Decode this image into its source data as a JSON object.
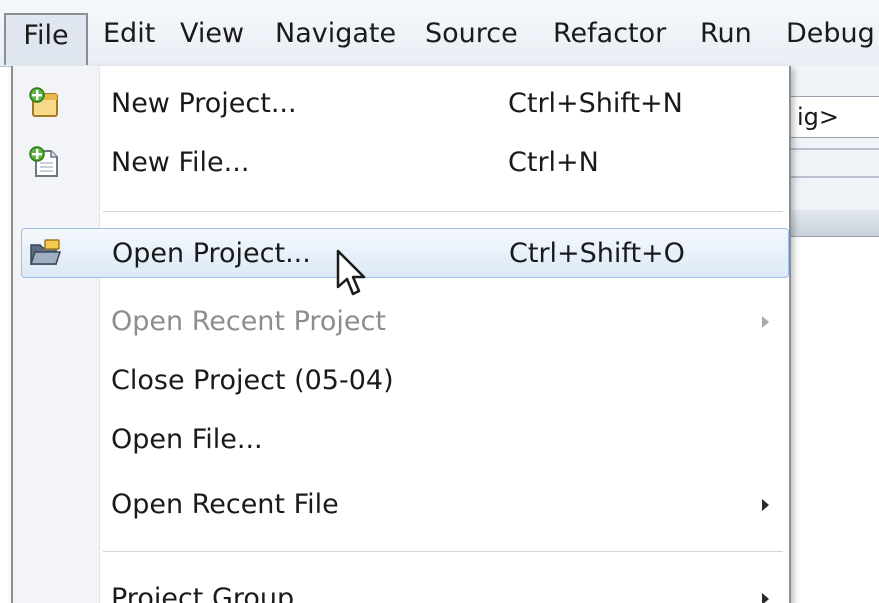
{
  "menubar": {
    "items": [
      {
        "label": "File"
      },
      {
        "label": "Edit"
      },
      {
        "label": "View"
      },
      {
        "label": "Navigate"
      },
      {
        "label": "Source"
      },
      {
        "label": "Refactor"
      },
      {
        "label": "Run"
      },
      {
        "label": "Debug"
      }
    ],
    "open_menu": "File"
  },
  "background": {
    "config_combo_value": "ig>"
  },
  "file_menu": {
    "items": [
      {
        "label": "New Project...",
        "shortcut": "Ctrl+Shift+N",
        "icon": "new-project-icon",
        "enabled": true
      },
      {
        "label": "New File...",
        "shortcut": "Ctrl+N",
        "icon": "new-file-icon",
        "enabled": true
      },
      {
        "label": "Open Project...",
        "shortcut": "Ctrl+Shift+O",
        "icon": "open-project-icon",
        "enabled": true,
        "highlighted": true
      },
      {
        "label": "Open Recent Project",
        "shortcut": "",
        "enabled": false,
        "submenu": true
      },
      {
        "label": "Close Project (05-04)",
        "shortcut": "",
        "enabled": true
      },
      {
        "label": "Open File...",
        "shortcut": "",
        "enabled": true
      },
      {
        "label": "Open Recent File",
        "shortcut": "",
        "enabled": true,
        "submenu": true
      },
      {
        "label": "Project Group",
        "shortcut": "",
        "enabled": true,
        "submenu": true
      }
    ]
  },
  "colors": {
    "highlight_border": "#9fbfe4",
    "highlight_fill": "#dce9f7",
    "disabled_text": "#8d8d8d",
    "menubar_bg": "#e9eef5"
  },
  "cursor": {
    "icon": "mouse-pointer-icon"
  }
}
